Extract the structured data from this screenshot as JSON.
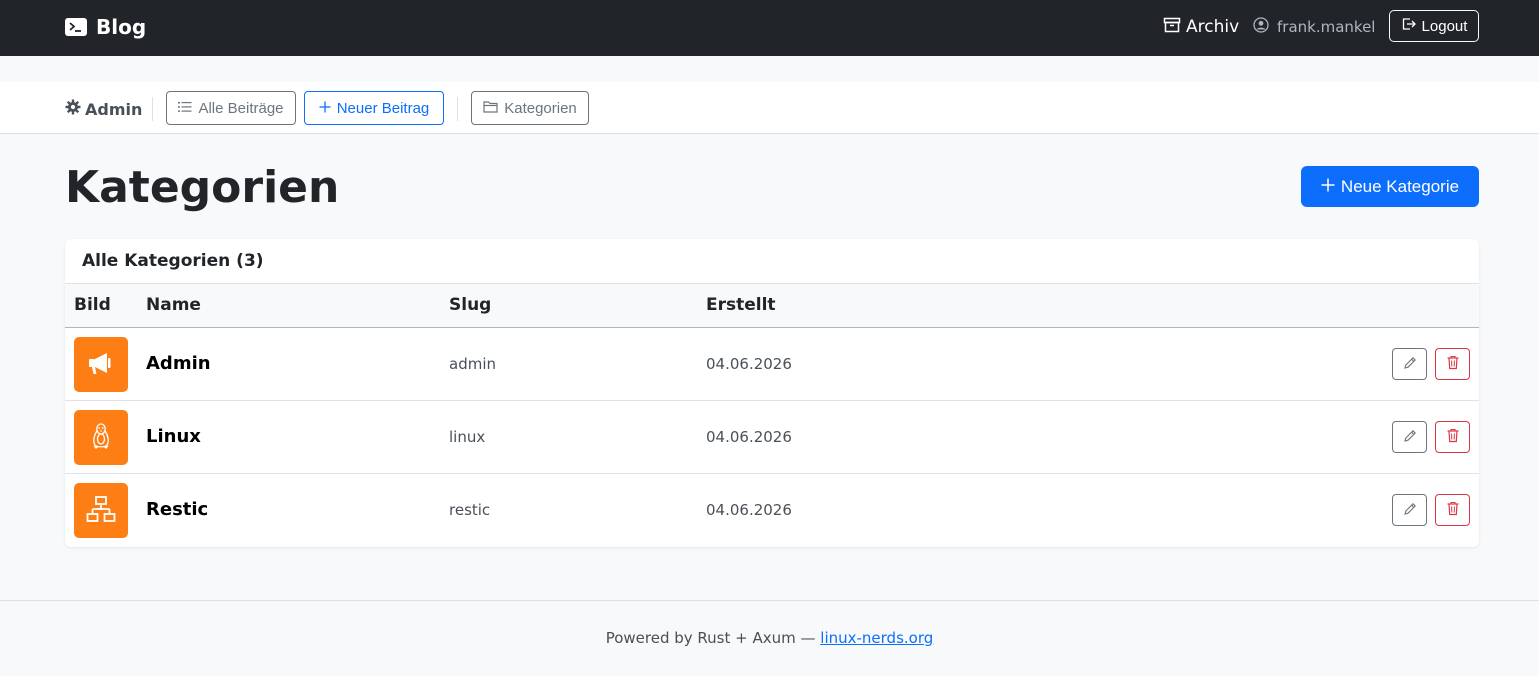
{
  "navbar": {
    "brand": "Blog",
    "archive_label": "Archiv",
    "username": "frank.mankel",
    "logout_label": "Logout"
  },
  "admin_nav": {
    "admin_label": "Admin",
    "all_posts_label": "Alle Beiträge",
    "new_post_label": "Neuer Beitrag",
    "categories_label": "Kategorien"
  },
  "main": {
    "title": "Kategorien",
    "new_category_label": "Neue Kategorie",
    "card_title": "Alle Kategorien (3)",
    "columns": [
      "Bild",
      "Name",
      "Slug",
      "Erstellt"
    ],
    "rows": [
      {
        "icon": "megaphone-icon",
        "name": "Admin",
        "slug": "admin",
        "created": "04.06.2026"
      },
      {
        "icon": "penguin-icon",
        "name": "Linux",
        "slug": "linux",
        "created": "04.06.2026"
      },
      {
        "icon": "network-icon",
        "name": "Restic",
        "slug": "restic",
        "created": "04.06.2026"
      }
    ]
  },
  "footer": {
    "prefix": "Powered by Rust + Axum — ",
    "link_text": "linux-nerds.org"
  },
  "colors": {
    "navbar_bg": "#212529",
    "primary": "#0d6efd",
    "thumb_bg": "#fd7e14",
    "danger": "#dc3545"
  }
}
